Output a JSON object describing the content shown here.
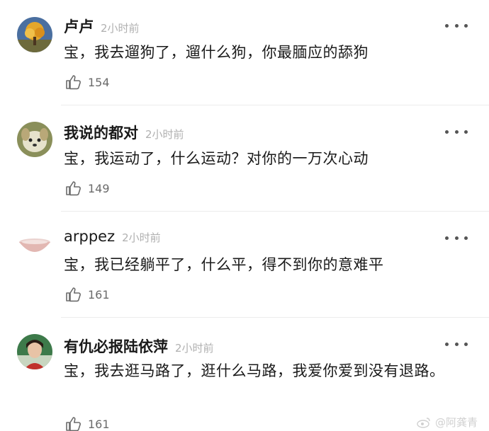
{
  "comments": [
    {
      "username": "卢卢",
      "time": "2小时前",
      "text": "宝，我去遛狗了，遛什么狗，你最腼应的舔狗",
      "likes": "154",
      "avatar_icon": "tree-avatar"
    },
    {
      "username": "我说的都对",
      "time": "2小时前",
      "text": "宝，我运动了，什么运动？对你的一万次心动",
      "likes": "149",
      "avatar_icon": "dog-avatar"
    },
    {
      "username": "arppez",
      "time": "2小时前",
      "text": "宝，我已经躺平了，什么平，得不到你的意难平",
      "likes": "161",
      "avatar_icon": "bowl-avatar"
    },
    {
      "username": "有仇必报陆依萍",
      "time": "2小时前",
      "text": "宝，我去逛马路了，逛什么马路，我爱你爱到没有退路。",
      "likes": "161",
      "avatar_icon": "person-avatar"
    }
  ],
  "watermark": {
    "text": "@阿龚青"
  },
  "colors": {
    "text": "#1a1a1a",
    "meta": "#b0b0b0",
    "like": "#6b6b6b",
    "divider": "#ececec"
  }
}
